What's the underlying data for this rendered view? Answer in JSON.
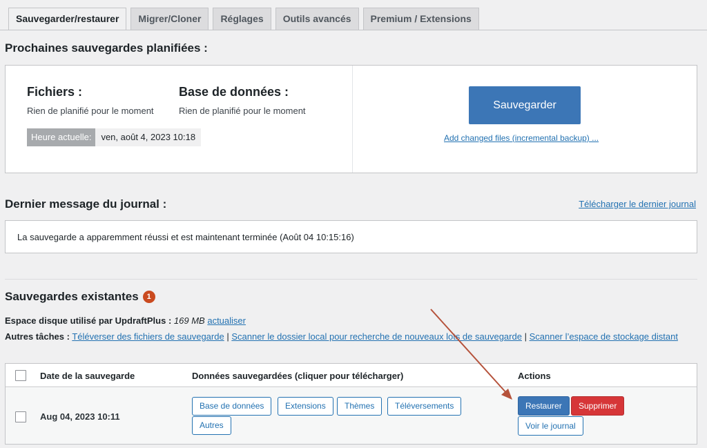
{
  "tabs": [
    "Sauvegarder/restaurer",
    "Migrer/Cloner",
    "Réglages",
    "Outils avancés",
    "Premium / Extensions"
  ],
  "scheduled": {
    "title": "Prochaines sauvegardes planifiées :",
    "files_heading": "Fichiers :",
    "files_text": "Rien de planifié pour le moment",
    "db_heading": "Base de données :",
    "db_text": "Rien de planifié pour le moment",
    "current_time_label": "Heure actuelle:",
    "current_time_value": "ven, août 4, 2023 10:18",
    "backup_button": "Sauvegarder",
    "incremental_link": "Add changed files (incremental backup) ..."
  },
  "log": {
    "title": "Dernier message du journal :",
    "download_link": "Télécharger le dernier journal",
    "message": "La sauvegarde a apparemment réussi et est maintenant terminée (Août 04 10:15:16)"
  },
  "existing": {
    "title": "Sauvegardes existantes",
    "count": "1",
    "disk_label": "Espace disque utilisé par UpdraftPlus :",
    "disk_value": "169 MB",
    "refresh_link": "actualiser",
    "other_tasks_label": "Autres tâches :",
    "task_upload": "Téléverser des fichiers de sauvegarde",
    "task_rescan_local": "Scanner le dossier local pour recherche de nouveaux lots de sauvegarde",
    "task_rescan_remote": "Scanner l’espace de stockage distant",
    "separator": "|"
  },
  "table": {
    "headers": {
      "date": "Date de la sauvegarde",
      "data": "Données sauvegardées (cliquer pour télécharger)",
      "actions": "Actions"
    },
    "rows": [
      {
        "date": "Aug 04, 2023 10:11",
        "data_buttons": [
          "Base de données",
          "Extensions",
          "Thèmes",
          "Téléversements",
          "Autres"
        ],
        "restore": "Restaurer",
        "delete": "Supprimer",
        "view_log": "Voir le journal"
      }
    ]
  },
  "colors": {
    "primary": "#3c76b6",
    "danger": "#d63638",
    "badge": "#ca4a1f",
    "link": "#2271b1",
    "annotation_arrow": "#b5523b"
  }
}
